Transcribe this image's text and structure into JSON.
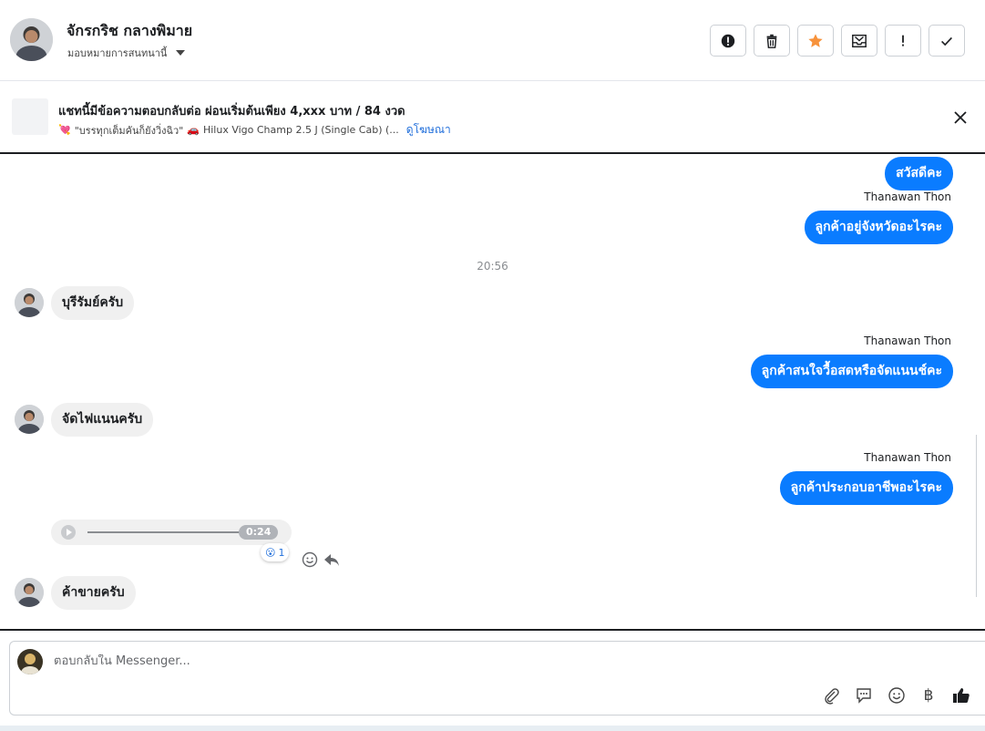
{
  "header": {
    "contact_name": "จักรกริช กลางพิมาย",
    "assign_label": "มอบหมายการสนทนานี้",
    "actions": [
      {
        "name": "alert-icon",
        "label": "Mark as spam"
      },
      {
        "name": "trash-icon",
        "label": "Delete"
      },
      {
        "name": "star-icon",
        "label": "Star"
      },
      {
        "name": "mark-unread-icon",
        "label": "Mark as unread"
      },
      {
        "name": "exclamation-icon",
        "label": "Follow up"
      },
      {
        "name": "check-icon",
        "label": "Mark as done"
      }
    ],
    "star_color": "#f7923b"
  },
  "ad_banner": {
    "title": "แชทนี้มีข้อความตอบกลับต่อ ผ่อนเริ่มต้นเพียง 4,xxx บาท / 84 งวด",
    "subtitle_emoji": "💘",
    "subtitle_text": "\"บรรทุกเต็มคันก็ยังวิ่งฉิว\"",
    "car_emoji": "🚗",
    "car_text": "Hilux Vigo Champ 2.5 J (Single Cab) (...",
    "link_label": "ดูโฆษณา"
  },
  "chat": {
    "messages": [
      {
        "kind": "out",
        "text": "สวัสดีคะ"
      },
      {
        "kind": "sender",
        "text": "Thanawan Thon"
      },
      {
        "kind": "out",
        "text": "ลูกค้าอยู่จังหวัดอะไรคะ"
      },
      {
        "kind": "time",
        "text": "20:56"
      },
      {
        "kind": "in",
        "text": "บุรีรัมย์ครับ"
      },
      {
        "kind": "sender",
        "text": "Thanawan Thon"
      },
      {
        "kind": "out",
        "text": "ลูกค้าสนใจวื้อสดหรือจัดแนนช์คะ"
      },
      {
        "kind": "in",
        "text": "จัดไฟแนนครับ"
      },
      {
        "kind": "sender",
        "text": "Thanawan Thon"
      },
      {
        "kind": "out",
        "text": "ลูกค้าประกอบอาชีพอะไรคะ"
      },
      {
        "kind": "in",
        "text": "ค้าขายครับ"
      }
    ],
    "audio": {
      "duration": "0:24",
      "progress": 1.0
    },
    "reaction": {
      "emoji": "😮",
      "count": "1"
    },
    "accent_color": "#0a7cff"
  },
  "composer": {
    "placeholder": "ตอบกลับใน Messenger...",
    "value": "",
    "tools": [
      "paperclip-icon",
      "saved-reply-icon",
      "emoji-icon",
      "baht-icon",
      "thumbs-up-icon"
    ],
    "baht_symbol": "฿"
  }
}
